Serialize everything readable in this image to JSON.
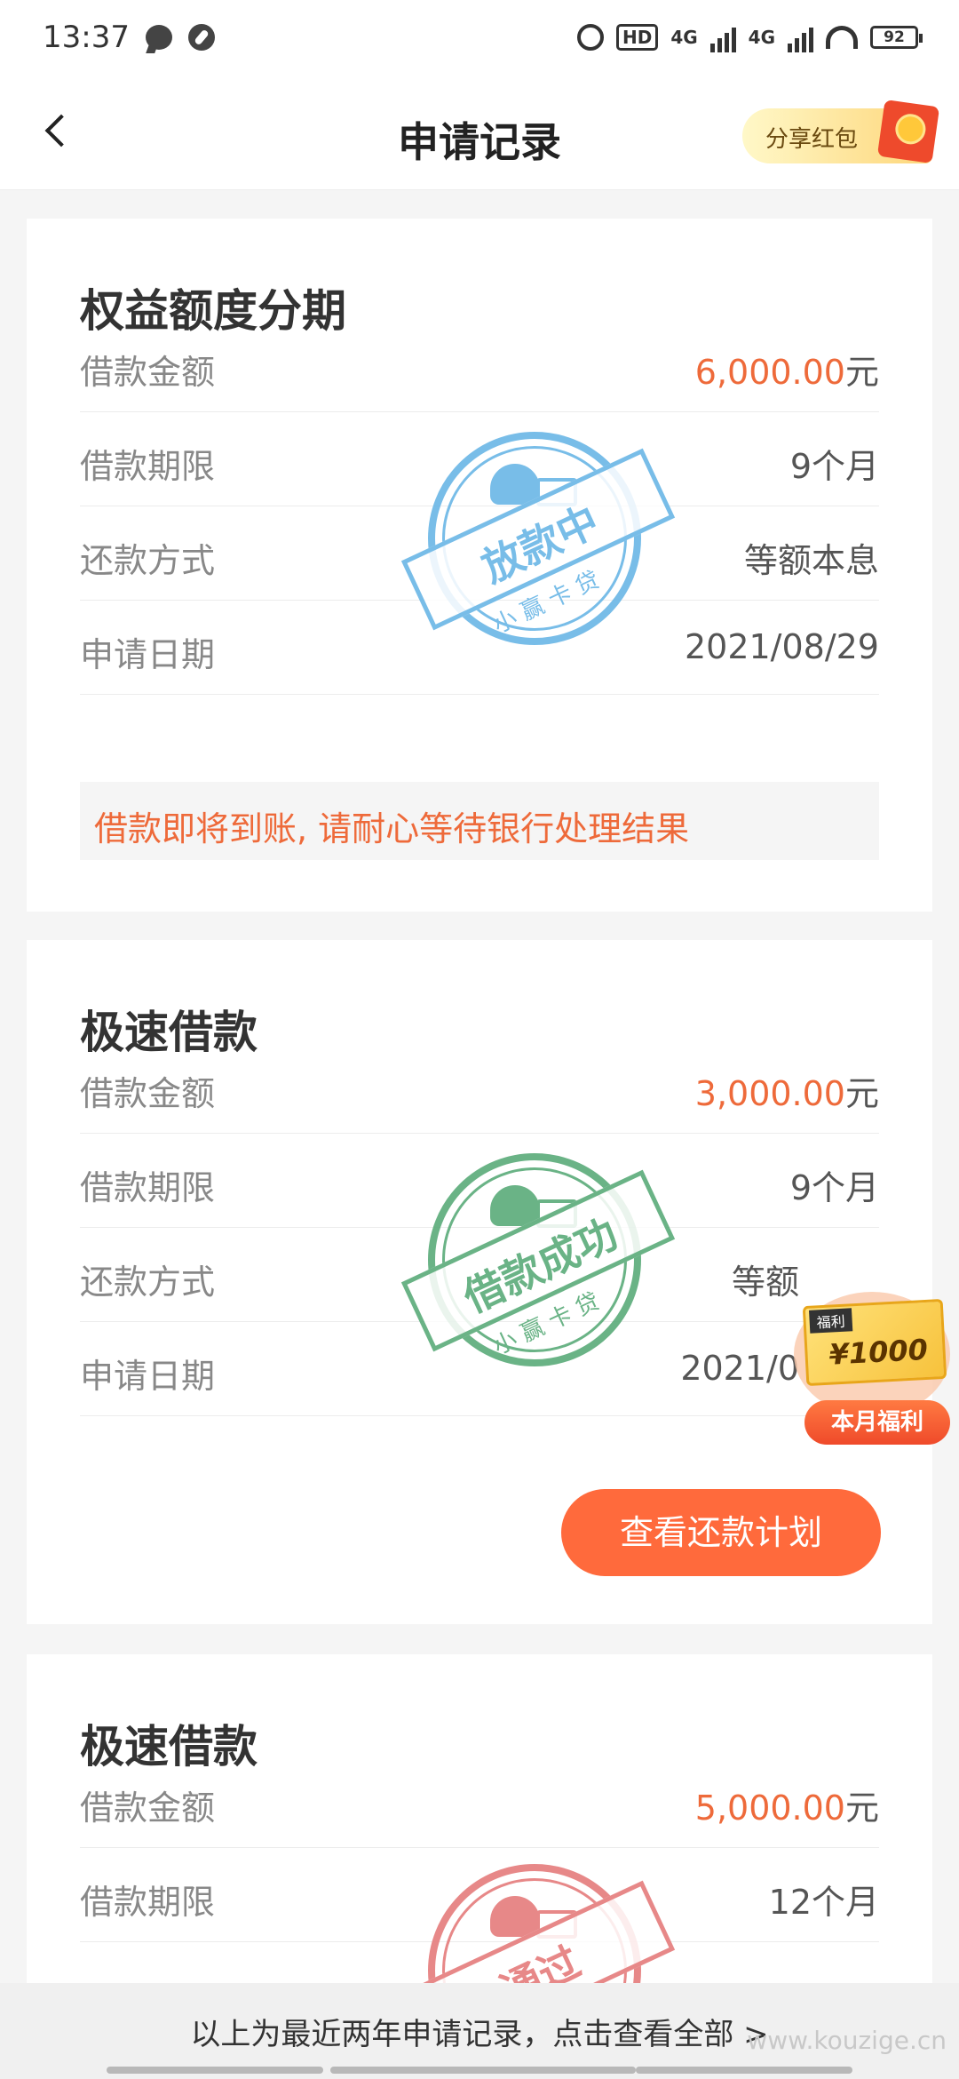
{
  "status_bar": {
    "time": "13:37",
    "icons": [
      "chat-icon",
      "compass-icon",
      "alarm-icon",
      "hd-icon",
      "signal-icon",
      "signal-icon",
      "wifi-icon",
      "battery-icon"
    ],
    "hd": "HD",
    "net1": "4G",
    "net2": "4G",
    "battery": "92"
  },
  "header": {
    "title": "申请记录",
    "share_label": "分享红包",
    "back_icon": "chevron-left-icon"
  },
  "records": [
    {
      "title": "权益额度分期",
      "amount_label": "借款金额",
      "amount_value": "6,000.00",
      "amount_unit": "元",
      "term_label": "借款期限",
      "term_value": "9个月",
      "method_label": "还款方式",
      "method_value": "等额本息",
      "date_label": "申请日期",
      "date_value": "2021/08/29",
      "notice": "借款即将到账, 请耐心等待银行处理结果",
      "stamp_text": "放款中",
      "stamp_sub": "小赢卡贷",
      "stamp_color": "#6ab6e6"
    },
    {
      "title": "极速借款",
      "amount_label": "借款金额",
      "amount_value": "3,000.00",
      "amount_unit": "元",
      "term_label": "借款期限",
      "term_value": "9个月",
      "method_label": "还款方式",
      "method_value": "等额",
      "date_label": "申请日期",
      "date_value": "2021/0",
      "button_label": "查看还款计划",
      "stamp_text": "借款成功",
      "stamp_sub": "小赢卡贷",
      "stamp_color": "#5aab79"
    },
    {
      "title": "极速借款",
      "amount_label": "借款金额",
      "amount_value": "5,000.00",
      "amount_unit": "元",
      "term_label": "借款期限",
      "term_value": "12个月",
      "stamp_text": "通过",
      "stamp_color": "#e57c7c"
    }
  ],
  "welfare": {
    "tag": "福利",
    "amount": "¥1000",
    "label": "本月福利"
  },
  "footer": {
    "link": "以上为最近两年申请记录，点击查看全部 >",
    "watermark": "www.kouzige.cn"
  }
}
